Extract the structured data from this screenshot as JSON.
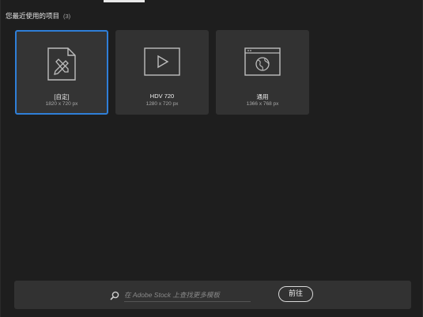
{
  "recent": {
    "heading": "您最近使用的项目",
    "count": "(3)"
  },
  "presets": [
    {
      "title": "[自定]",
      "size": "1820 x 720 px",
      "icon": "custom-document-icon",
      "selected": true
    },
    {
      "title": "HDV 720",
      "size": "1280 x 720 px",
      "icon": "video-play-icon",
      "selected": false
    },
    {
      "title": "通用",
      "size": "1366 x 768 px",
      "icon": "web-globe-icon",
      "selected": false
    }
  ],
  "stock": {
    "search_placeholder": "在 Adobe Stock 上查找更多模板",
    "go_label": "前往",
    "icon": "search-icon"
  },
  "colors": {
    "background": "#1e1e1e",
    "card": "#323232",
    "selected_border": "#2f7fd8",
    "text": "#e6e6e6",
    "muted_text": "#a8a8a8"
  }
}
